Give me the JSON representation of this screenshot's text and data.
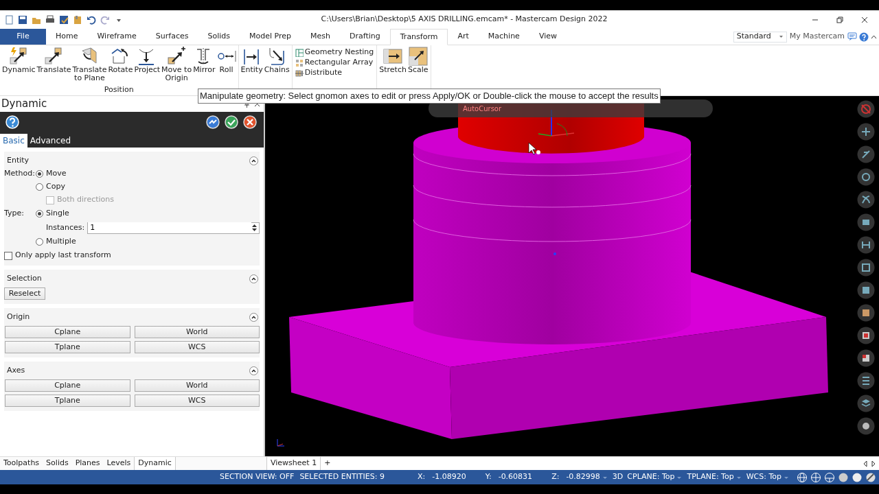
{
  "window": {
    "title": "C:\\Users\\Brian\\Desktop\\5 AXIS DRILLING.emcam* - Mastercam Design 2022"
  },
  "ribbon": {
    "file_tab": "File",
    "tabs": [
      {
        "label": "Home",
        "selected": false
      },
      {
        "label": "Wireframe",
        "selected": false
      },
      {
        "label": "Surfaces",
        "selected": false
      },
      {
        "label": "Solids",
        "selected": false
      },
      {
        "label": "Model Prep",
        "selected": false
      },
      {
        "label": "Mesh",
        "selected": false
      },
      {
        "label": "Drafting",
        "selected": false
      },
      {
        "label": "Transform",
        "selected": true
      },
      {
        "label": "Art",
        "selected": false
      },
      {
        "label": "Machine",
        "selected": false
      },
      {
        "label": "View",
        "selected": false
      }
    ],
    "mode_select": "Standard",
    "my_mastercam": "My Mastercam",
    "groups": [
      {
        "kind": "large",
        "label": "Position",
        "buttons": [
          "Dynamic",
          "Translate",
          "Translate\nto Plane",
          "Rotate",
          "Project",
          "Move to\nOrigin",
          "Mirror",
          "Roll"
        ]
      },
      {
        "kind": "large",
        "buttons": [
          "Entity",
          "Chains"
        ]
      },
      {
        "kind": "small",
        "buttons": [
          "Geometry Nesting",
          "Rectangular Array",
          "Distribute"
        ]
      },
      {
        "kind": "large",
        "buttons": [
          "Stretch",
          "Scale"
        ]
      }
    ]
  },
  "tooltip": "Manipulate geometry: Select gnomon axes to edit or press Apply/OK or Double-click the mouse to accept the results",
  "panel": {
    "title": "Dynamic",
    "tabs": [
      {
        "label": "Basic",
        "selected": true
      },
      {
        "label": "Advanced",
        "selected": false
      }
    ],
    "entity": {
      "title": "Entity",
      "method_label": "Method:",
      "methods": [
        {
          "label": "Move",
          "selected": true
        },
        {
          "label": "Copy",
          "selected": false
        }
      ],
      "both_directions": {
        "label": "Both directions",
        "checked": false,
        "disabled": true
      },
      "type_label": "Type:",
      "types": [
        {
          "label": "Single",
          "selected": true
        },
        {
          "label": "Multiple",
          "selected": false
        }
      ],
      "instances": {
        "label": "Instances:",
        "value": "1"
      },
      "only_last": {
        "label": "Only apply last transform",
        "checked": false
      }
    },
    "selection": {
      "title": "Selection",
      "button": "Reselect"
    },
    "origin": {
      "title": "Origin",
      "buttons": [
        "Cplane",
        "World",
        "Tplane",
        "WCS"
      ]
    },
    "axes": {
      "title": "Axes",
      "buttons": [
        "Cplane",
        "World",
        "Tplane",
        "WCS"
      ]
    }
  },
  "manager_tabs": [
    {
      "label": "Toolpaths",
      "selected": false
    },
    {
      "label": "Solids",
      "selected": false
    },
    {
      "label": "Planes",
      "selected": false
    },
    {
      "label": "Levels",
      "selected": false
    },
    {
      "label": "Dynamic",
      "selected": true
    }
  ],
  "viewsheets": {
    "tabs": [
      {
        "label": "Viewsheet 1",
        "selected": true
      }
    ],
    "add": "+"
  },
  "viewport": {
    "autocursor": "AutoCursor"
  },
  "status_bar": {
    "section_view": "SECTION VIEW: OFF",
    "selected": "SELECTED ENTITIES: 9",
    "coords": [
      {
        "axis": "X:",
        "value": "-1.08920"
      },
      {
        "axis": "Y:",
        "value": "-0.60831"
      },
      {
        "axis": "Z:",
        "value": "-0.82998"
      }
    ],
    "planes": [
      "3D",
      "CPLANE: Top",
      "TPLANE: Top",
      "WCS: Top"
    ]
  }
}
